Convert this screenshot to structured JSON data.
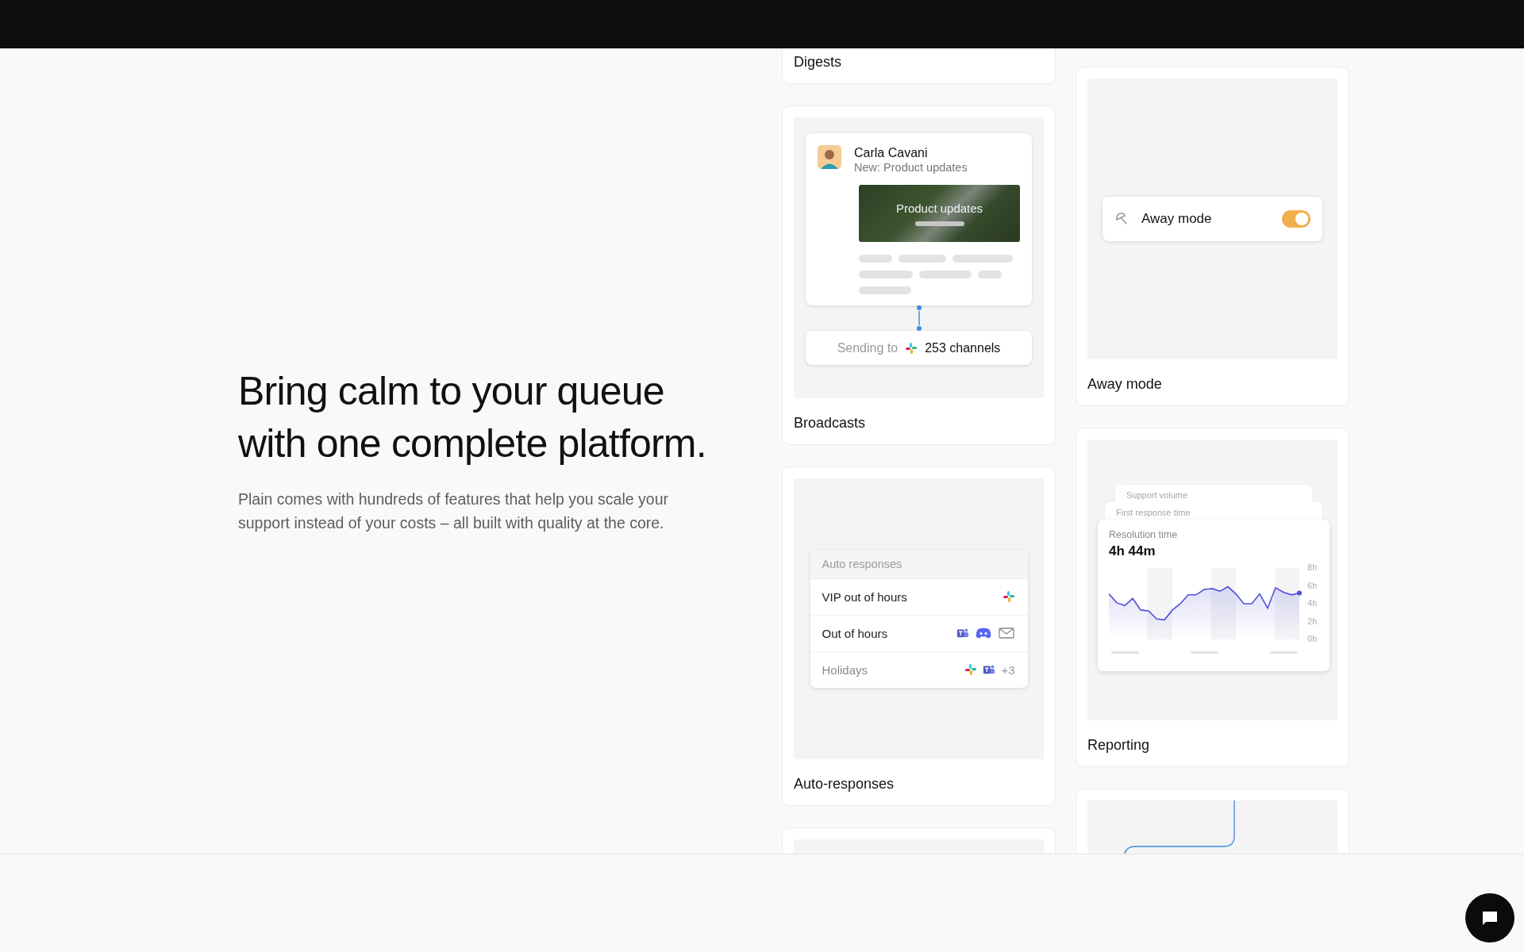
{
  "hero": {
    "title": "Bring calm to your queue with one complete platform.",
    "description": "Plain comes with hundreds of features that help you scale your support instead of your costs – all built with quality at the core."
  },
  "feature_columns": [
    {
      "cards": [
        {
          "kind": "digests",
          "title": "Digests"
        },
        {
          "kind": "broadcasts",
          "title": "Broadcasts",
          "message": {
            "sender": "Carla Cavani",
            "subject": "New: Product updates",
            "banner": "Product updates"
          },
          "target": {
            "prefix": "Sending to",
            "count": "253 channels"
          }
        },
        {
          "kind": "auto_responses",
          "title": "Auto-responses",
          "panel": {
            "heading": "Auto responses",
            "rows": [
              {
                "name": "VIP out of hours",
                "dimmed": false,
                "channels": [
                  {
                    "kind": "pinwheel"
                  }
                ]
              },
              {
                "name": "Out of hours",
                "dimmed": false,
                "channels": [
                  {
                    "kind": "team"
                  },
                  {
                    "kind": "controller"
                  },
                  {
                    "kind": "mail"
                  }
                ]
              },
              {
                "name": "Holidays",
                "dimmed": true,
                "channels": [
                  {
                    "kind": "pinwheel"
                  },
                  {
                    "kind": "team"
                  }
                ],
                "more": "+3"
              }
            ]
          }
        },
        {
          "kind": "blank"
        }
      ]
    },
    {
      "cards": [
        {
          "kind": "away_mode",
          "title": "Away mode",
          "toggle": {
            "label": "Away mode",
            "on": true
          }
        },
        {
          "kind": "reporting",
          "title": "Reporting",
          "stack": [
            "Support volume",
            "First response time"
          ],
          "metric": {
            "label": "Resolution time",
            "value": "4h 44m"
          },
          "chart_data": {
            "type": "area",
            "ylim": [
              0,
              8
            ],
            "yticks": [
              {
                "value": 0,
                "label": "0h"
              },
              {
                "value": 2,
                "label": "2h"
              },
              {
                "value": 4,
                "label": "4h"
              },
              {
                "value": 6,
                "label": "6h"
              },
              {
                "value": 8,
                "label": "8h"
              }
            ],
            "series": [
              {
                "color": "#4f4fd9",
                "values": [
                  5.1,
                  4.1,
                  3.8,
                  4.6,
                  3.3,
                  3.2,
                  2.3,
                  2.2,
                  3.3,
                  4.0,
                  5.0,
                  5.0,
                  5.6,
                  5.7,
                  5.4,
                  5.9,
                  5.1,
                  4.0,
                  4.0,
                  5.1,
                  3.5,
                  5.8,
                  5.3,
                  5.0,
                  5.2
                ]
              }
            ]
          }
        },
        {
          "kind": "workflow"
        }
      ]
    }
  ]
}
